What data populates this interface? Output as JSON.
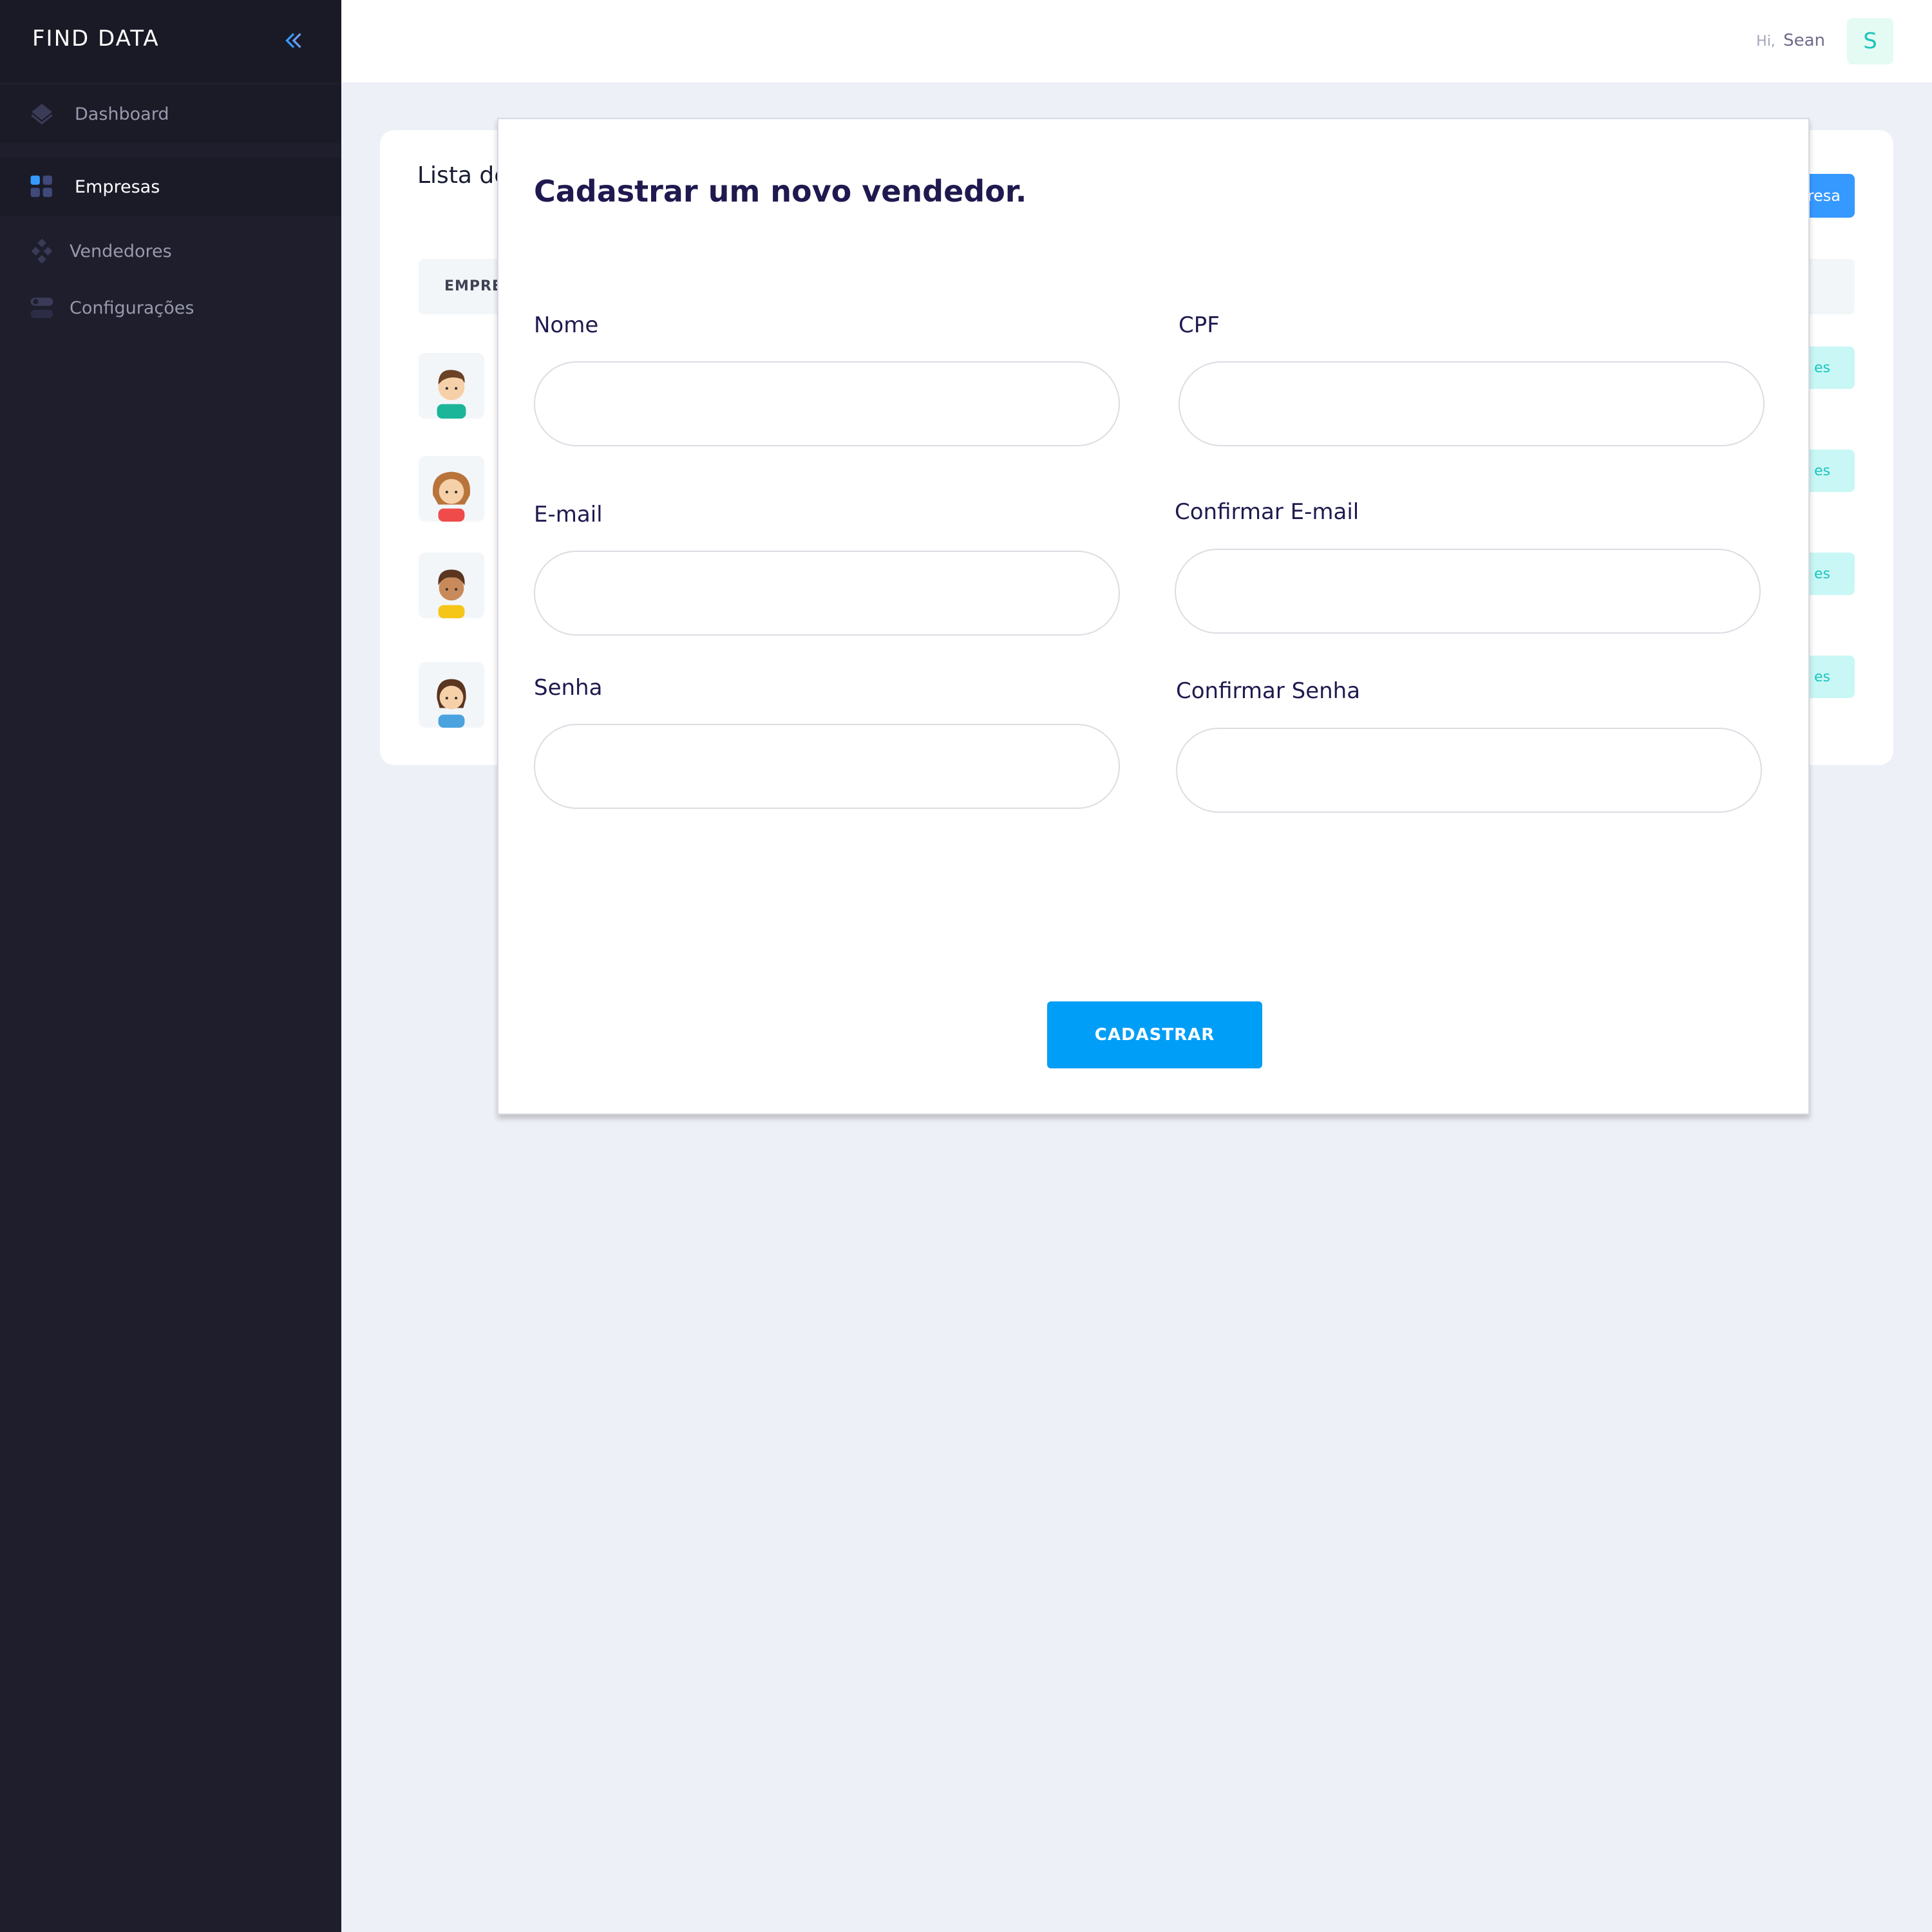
{
  "app": {
    "brand": "FIND DATA"
  },
  "sidebar": {
    "items": [
      {
        "label": "Dashboard",
        "icon": "layers-icon"
      },
      {
        "label": "Empresas",
        "icon": "grid-icon",
        "active": true
      },
      {
        "label": "Vendedores",
        "icon": "diamond-grid-icon"
      },
      {
        "label": "Configurações",
        "icon": "toggle-icon"
      }
    ]
  },
  "header": {
    "greeting_prefix": "Hi,",
    "user_name": "Sean",
    "avatar_letter": "S"
  },
  "card": {
    "title": "Lista de",
    "add_button": "resa",
    "column_header": "EMPRE",
    "row_action_label": "es"
  },
  "modal": {
    "title": "Cadastrar um novo vendedor.",
    "fields": {
      "nome": {
        "label": "Nome",
        "value": ""
      },
      "cpf": {
        "label": "CPF",
        "value": ""
      },
      "email": {
        "label": "E-mail",
        "value": ""
      },
      "confirm_email": {
        "label": "Confirmar E-mail",
        "value": ""
      },
      "senha": {
        "label": "Senha",
        "value": ""
      },
      "confirm_senha": {
        "label": "Confirmar Senha",
        "value": ""
      }
    },
    "submit_label": "CADASTRAR"
  },
  "colors": {
    "sidebar_bg": "#1e1e2d",
    "accent_blue": "#009ef7",
    "teal": "#1bc5bd",
    "heading": "#1e1a4f"
  }
}
